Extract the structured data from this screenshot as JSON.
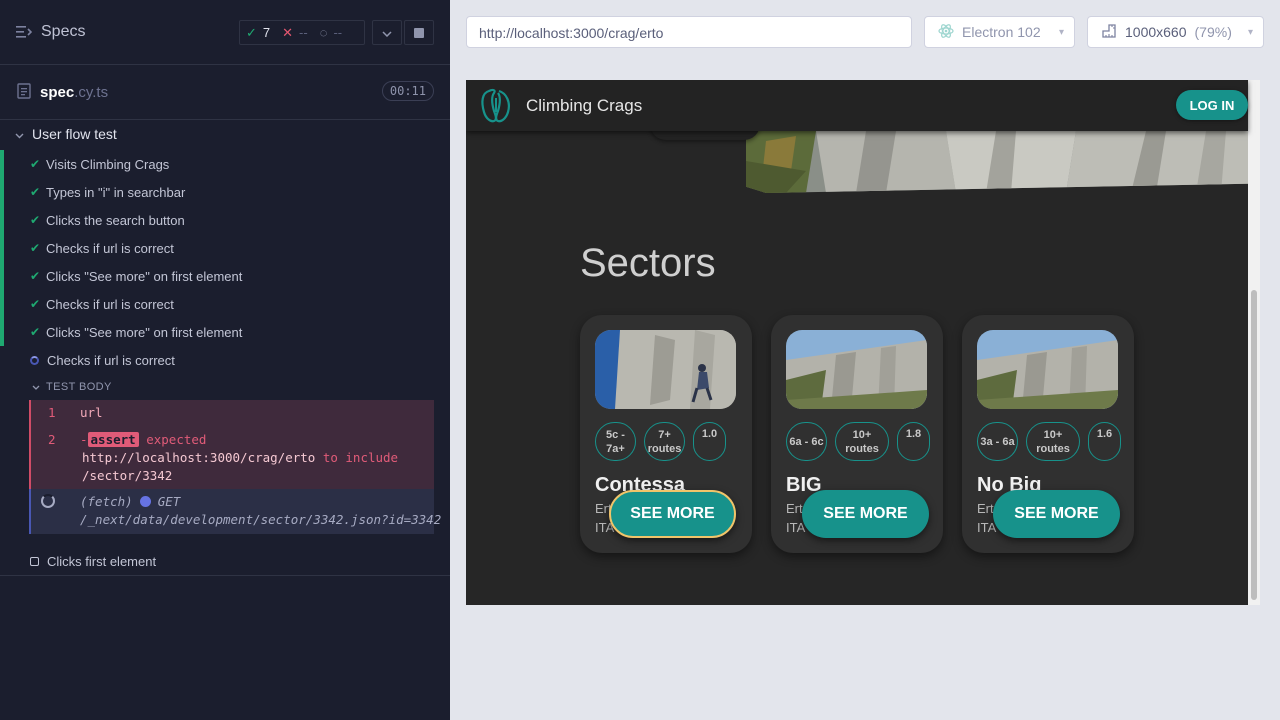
{
  "reporter": {
    "specs_label": "Specs",
    "stats": {
      "passed": "7",
      "failed": "--",
      "pending": "--"
    },
    "spec_file": {
      "base": "spec",
      "ext": ".cy.ts",
      "duration": "00:11"
    },
    "suite_title": "User flow test",
    "tests": [
      {
        "label": "Visits Climbing Crags",
        "state": "passed"
      },
      {
        "label": "Types in \"i\" in searchbar",
        "state": "passed"
      },
      {
        "label": "Clicks the search button",
        "state": "passed"
      },
      {
        "label": "Checks if url is correct",
        "state": "passed"
      },
      {
        "label": "Clicks \"See more\" on first element",
        "state": "passed"
      },
      {
        "label": "Checks if url is correct",
        "state": "passed"
      },
      {
        "label": "Clicks \"See more\" on first element",
        "state": "passed"
      },
      {
        "label": "Checks if url is correct",
        "state": "running"
      }
    ],
    "test_body_label": "TEST BODY",
    "commands": {
      "c1": {
        "num": "1",
        "text": "url"
      },
      "c2": {
        "num": "2",
        "prefix": "-",
        "tag": "assert",
        "expected": "expected",
        "url": "http://localhost:3000/crag/erto",
        "to_include": "to include",
        "target": "/sector/3342"
      },
      "fetch": {
        "type": "(fetch)",
        "method": "GET",
        "path": "/_next/data/development/sector/3342.json?id=3342"
      }
    },
    "next_test": {
      "label": "Clicks first element",
      "state": "pending"
    }
  },
  "toolbar": {
    "url": "http://localhost:3000/crag/erto",
    "browser": "Electron 102",
    "viewport": "1000x660",
    "viewport_scale": "(79%)"
  },
  "app": {
    "brand": "Climbing Crags",
    "login_label": "LOG IN",
    "sectors_title": "Sectors",
    "cards": [
      {
        "name": "Contessa",
        "loc1": "Erto",
        "loc2": "ITA",
        "grade": "5c - 7a+",
        "routes": "7+ routes",
        "third": "1.0",
        "button": "SEE MORE"
      },
      {
        "name": "BIG",
        "loc1": "Erto",
        "loc2": "ITA",
        "grade": "6a - 6c",
        "routes": "10+ routes",
        "third": "1.8",
        "button": "SEE MORE"
      },
      {
        "name": "No Big",
        "loc1": "Erto",
        "loc2": "ITA",
        "grade": "3a - 6a",
        "routes": "10+ routes",
        "third": "1.6",
        "button": "SEE MORE"
      }
    ]
  },
  "colors": {
    "reporter_bg": "#1b1e2e",
    "pass": "#1fa971",
    "fail": "#e05b78",
    "accent_teal": "#17928b",
    "app_bg": "#262626"
  }
}
